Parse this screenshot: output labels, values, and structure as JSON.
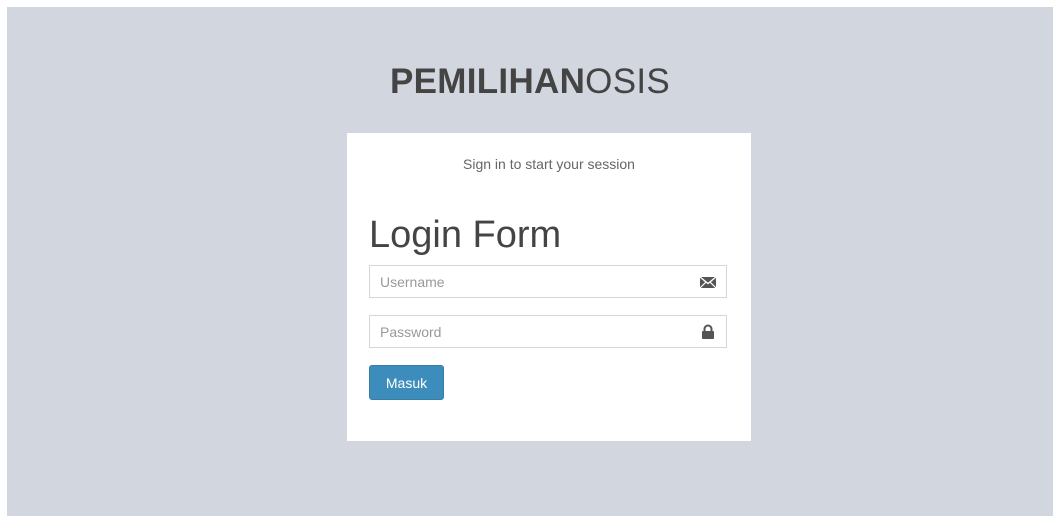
{
  "logo": {
    "bold": "PEMILIHAN",
    "light": "OSIS"
  },
  "login_box": {
    "message": "Sign in to start your session",
    "form_title": "Login Form",
    "username": {
      "placeholder": "Username",
      "value": "",
      "icon": "envelope-icon"
    },
    "password": {
      "placeholder": "Password",
      "value": "",
      "icon": "lock-icon"
    },
    "submit_label": "Masuk"
  },
  "colors": {
    "page_background": "#d2d6de",
    "box_background": "#ffffff",
    "button_primary": "#3c8dbc",
    "text_dark": "#444444"
  }
}
